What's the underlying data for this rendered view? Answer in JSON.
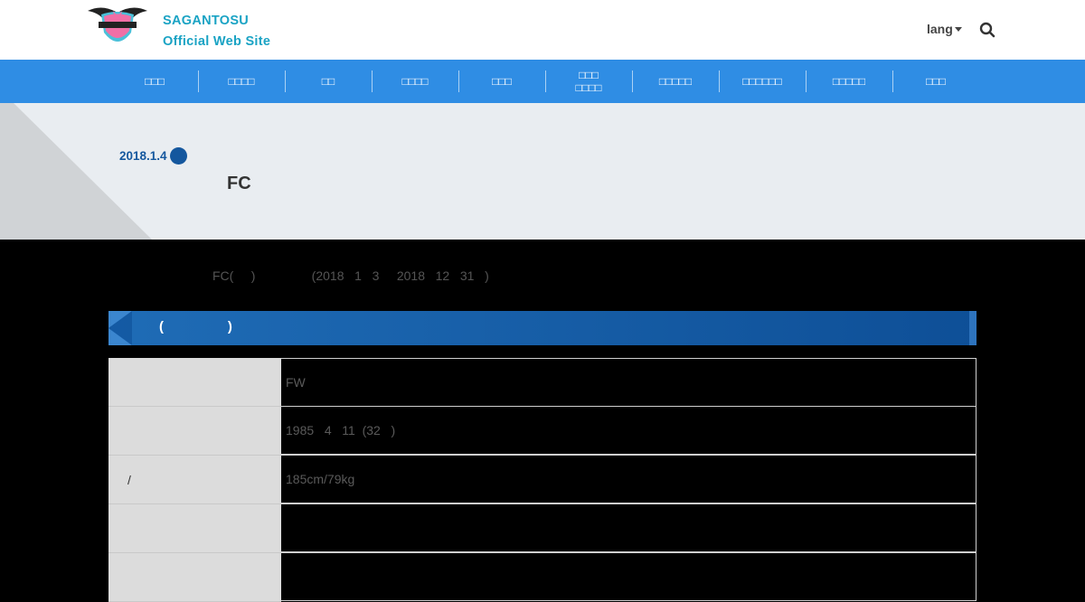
{
  "header": {
    "site_name_line1": "SAGANTOSU",
    "site_name_line2": "Official Web Site",
    "lang_label": "lang"
  },
  "nav": {
    "items": [
      "□□□",
      "□□□□",
      "□□",
      "□□□□",
      "□□□",
      "□□□\n□□□□",
      "□□□□□",
      "□□□□□□",
      "□□□□□",
      "□□□"
    ]
  },
  "hero": {
    "date": "2018.1.4",
    "title": "FC"
  },
  "content": {
    "intro": "FC(     )                (2018   1   3     2018   12   31   )",
    "section_title": "(                 )",
    "profile_rows": [
      {
        "key": "",
        "value": "FW"
      },
      {
        "key": "",
        "value": "1985   4   11  (32   )"
      },
      {
        "key": "/",
        "value": "185cm/79kg"
      },
      {
        "key": "",
        "value": ""
      },
      {
        "key": "",
        "value": ""
      }
    ]
  },
  "colors": {
    "accent": "#2f8de4",
    "brand_text": "#1aa3c4",
    "date": "#14579e",
    "section_bar": "#1f6cb6"
  }
}
